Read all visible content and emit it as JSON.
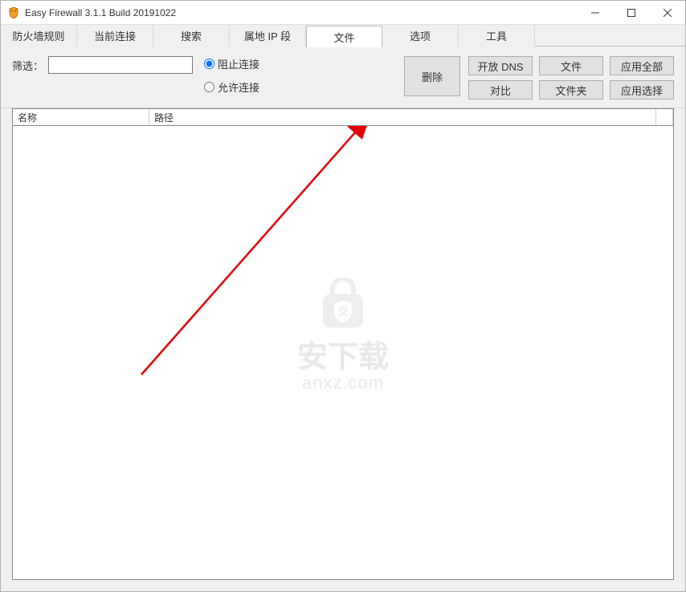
{
  "window": {
    "title": "Easy Firewall 3.1.1 Build 20191022"
  },
  "tabs": [
    {
      "label": "防火墙规则",
      "active": false
    },
    {
      "label": "当前连接",
      "active": false
    },
    {
      "label": "搜索",
      "active": false
    },
    {
      "label": "属地 IP 段",
      "active": false
    },
    {
      "label": "文件",
      "active": true
    },
    {
      "label": "选项",
      "active": false
    },
    {
      "label": "工具",
      "active": false
    }
  ],
  "toolbar": {
    "filter_label": "筛选：",
    "filter_value": "",
    "radio_block": "阻止连接",
    "radio_allow": "允许连接",
    "radio_selected": "block",
    "delete_btn": "删除",
    "buttons": {
      "open_dns": "开放 DNS",
      "file": "文件",
      "apply_all": "应用全部",
      "compare": "对比",
      "folder": "文件夹",
      "apply_selected": "应用选择"
    }
  },
  "table": {
    "columns": {
      "name": "名称",
      "path": "路径"
    },
    "rows": []
  },
  "watermark": {
    "main": "安下载",
    "sub": "anxz.com"
  }
}
